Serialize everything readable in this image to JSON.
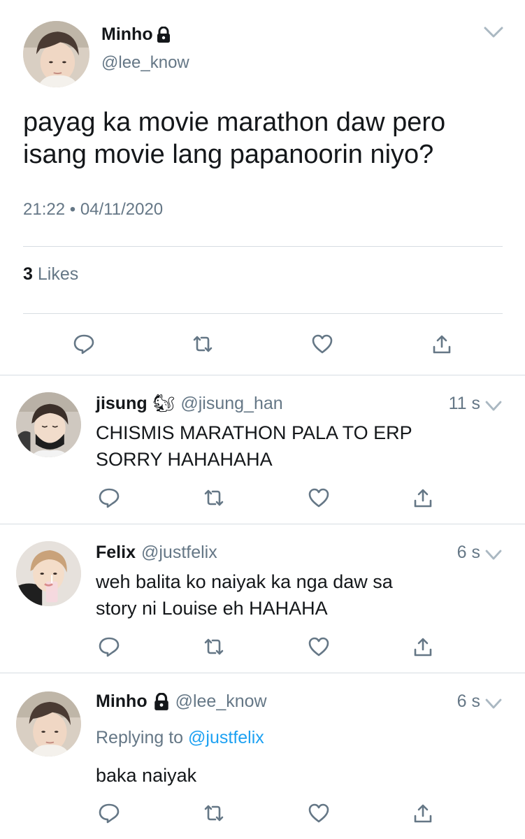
{
  "main_tweet": {
    "name": "Minho",
    "handle": "@lee_know",
    "text_line1": "payag ka movie marathon daw pero",
    "text_line2": "isang movie lang papanoorin niyo?",
    "time": "21:22",
    "date": "04/11/2020",
    "time_sep": "•",
    "likes_count": "3",
    "likes_label": "Likes"
  },
  "replies": [
    {
      "name": "jisung",
      "emoji": "🐿",
      "handle": "@jisung_han",
      "time": "11 s",
      "text_line1": "CHISMIS MARATHON PALA TO ERP",
      "text_line2": "SORRY HAHAHAHA"
    },
    {
      "name": "Felix",
      "handle": "@justfelix",
      "time": "6 s",
      "text_line1": "weh balita ko naiyak ka nga daw sa",
      "text_line2": "story ni Louise eh HAHAHA"
    },
    {
      "name": "Minho",
      "handle": "@lee_know",
      "time": "6 s",
      "replying_prefix": "Replying to",
      "replying_to": "@justfelix",
      "text_line1": "baka naiyak"
    }
  ],
  "colors": {
    "text": "#14171a",
    "secondary": "#657786",
    "link": "#1da1f2",
    "divider": "#d7dde2"
  },
  "icons": [
    "lock-icon",
    "chevron-down-icon",
    "reply-icon",
    "retweet-icon",
    "like-icon",
    "share-icon",
    "chipmunk-emoji"
  ]
}
